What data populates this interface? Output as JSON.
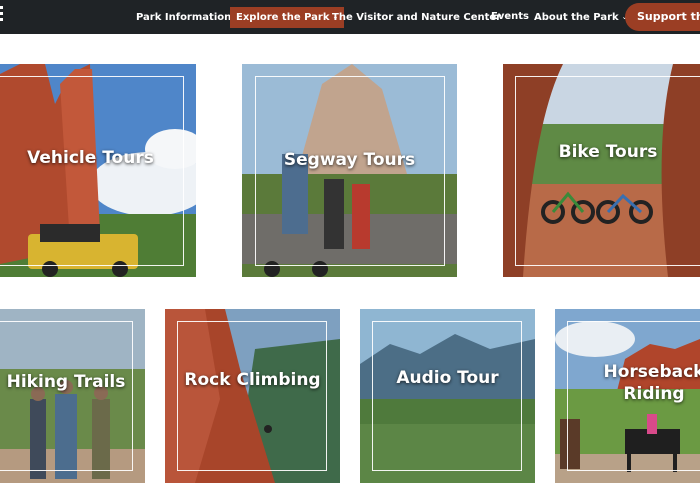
{
  "nav": {
    "items": [
      {
        "label": "Park Information",
        "dropdown": true,
        "active": false
      },
      {
        "label": "Explore the Park",
        "dropdown": true,
        "active": true
      },
      {
        "label": "The Visitor and Nature Center",
        "dropdown": true,
        "active": false
      },
      {
        "label": "Events",
        "dropdown": false,
        "active": false
      },
      {
        "label": "About the Park",
        "dropdown": true,
        "active": false
      }
    ],
    "support_label": "Support the P",
    "caret": "⌄"
  },
  "tiles": [
    {
      "label": "Vehicle Tours"
    },
    {
      "label": "Segway Tours"
    },
    {
      "label": "Bike Tours"
    },
    {
      "label": "Hiking Trails"
    },
    {
      "label": "Rock Climbing"
    },
    {
      "label": "Audio Tour"
    },
    {
      "label": "Horseback Riding"
    }
  ],
  "colors": {
    "nav_bg": "#1f2326",
    "accent": "#9b3e24",
    "text_light": "#ffffff"
  }
}
